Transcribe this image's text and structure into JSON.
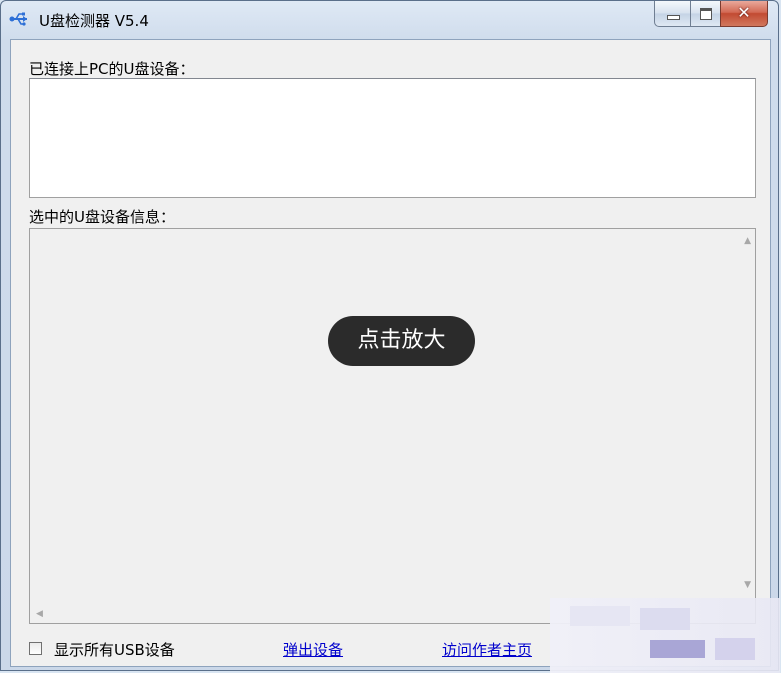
{
  "window": {
    "title": "U盘检测器 V5.4",
    "icon": "usb-icon",
    "controls": {
      "minimize": "minimize-icon",
      "maximize": "maximize-icon",
      "close": "✕"
    }
  },
  "connected_devices": {
    "label": "已连接上PC的U盘设备：",
    "items": []
  },
  "selected_info": {
    "label": "选中的U盘设备信息：",
    "overlay_button": "点击放大"
  },
  "footer": {
    "show_all_checkbox": {
      "label": "显示所有USB设备",
      "checked": false
    },
    "eject_link": "弹出设备",
    "author_link": "访问作者主页"
  },
  "colors": {
    "link": "#0000cc",
    "overlay_bg": "#2b2b2b",
    "close_button": "#c24a32"
  }
}
